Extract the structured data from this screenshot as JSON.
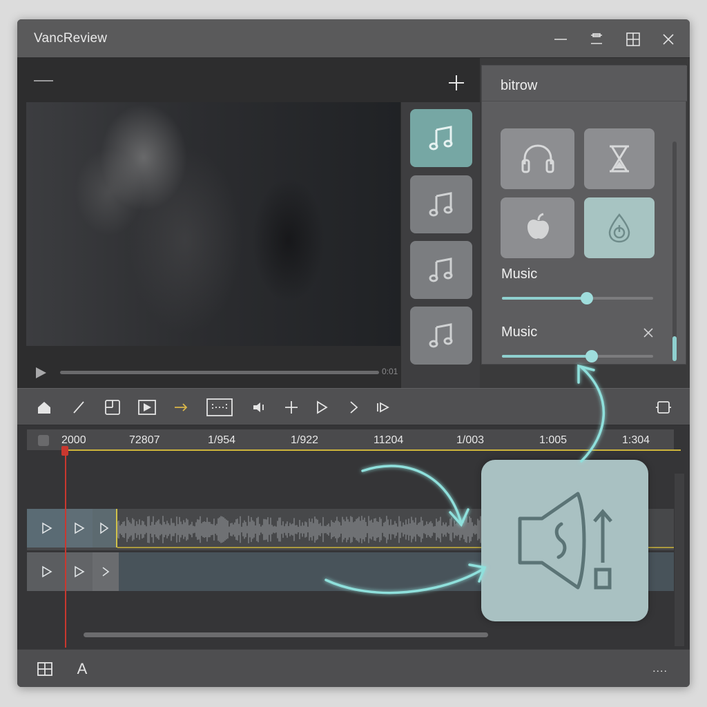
{
  "window": {
    "title": "VancReview"
  },
  "effects": {
    "title": "bitrow",
    "sliders": [
      {
        "label": "Music",
        "value": 0.56
      },
      {
        "label": "Music",
        "value": 0.59
      }
    ]
  },
  "preview": {
    "time": "0:01"
  },
  "timeline": {
    "ruler_labels": [
      "2000",
      "72807",
      "1/954",
      "1/922",
      "11204",
      "1/003",
      "1:005",
      "1:304"
    ]
  },
  "status": {
    "text_tool_label": "A",
    "more_label": "...."
  },
  "colors": {
    "accent": "#8fd0cf",
    "playhead": "#c9382f",
    "ruler_line": "#cdb53b"
  }
}
